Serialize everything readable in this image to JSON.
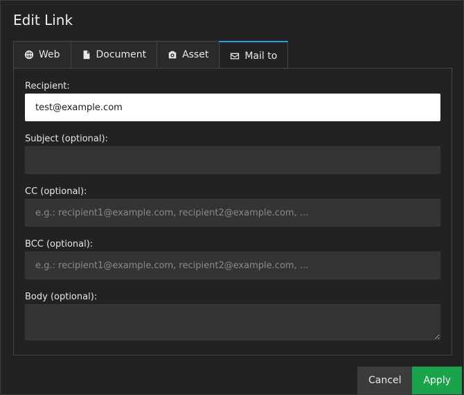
{
  "dialog": {
    "title": "Edit Link"
  },
  "tabs": [
    {
      "label": "Web",
      "icon": "globe-icon",
      "active": false
    },
    {
      "label": "Document",
      "icon": "document-icon",
      "active": false
    },
    {
      "label": "Asset",
      "icon": "camera-icon",
      "active": false
    },
    {
      "label": "Mail to",
      "icon": "envelope-icon",
      "active": true
    }
  ],
  "form": {
    "recipient": {
      "label": "Recipient:",
      "value": "test@example.com",
      "placeholder": ""
    },
    "subject": {
      "label": "Subject (optional):",
      "value": "",
      "placeholder": ""
    },
    "cc": {
      "label": "CC (optional):",
      "value": "",
      "placeholder": "e.g.: recipient1@example.com, recipient2@example.com, ..."
    },
    "bcc": {
      "label": "BCC (optional):",
      "value": "",
      "placeholder": "e.g.: recipient1@example.com, recipient2@example.com, ..."
    },
    "body": {
      "label": "Body (optional):",
      "value": "",
      "placeholder": ""
    }
  },
  "actions": {
    "cancel_label": "Cancel",
    "apply_label": "Apply"
  },
  "colors": {
    "accent": "#2aa1e6",
    "apply": "#1aa34a"
  }
}
